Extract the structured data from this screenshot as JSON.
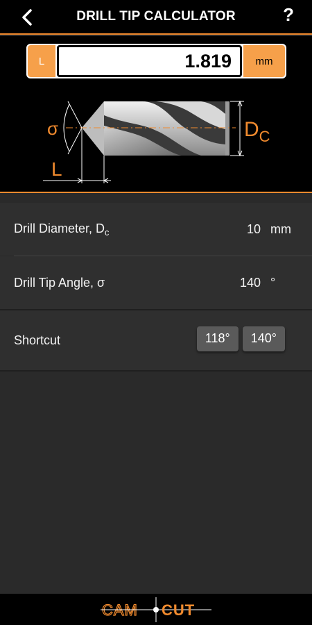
{
  "header": {
    "title": "DRILL TIP CALCULATOR",
    "help_label": "?"
  },
  "result": {
    "tag": "L",
    "value": "1.819",
    "unit": "mm"
  },
  "diagram": {
    "sigma_label": "σ",
    "L_label": "L",
    "dc_label_main": "D",
    "dc_label_sub": "C"
  },
  "rows": [
    {
      "label": "Drill Diameter, D",
      "label_sub": "c",
      "value": "10",
      "unit": "mm"
    },
    {
      "label": "Drill Tip Angle, σ",
      "value": "140",
      "unit": "°"
    }
  ],
  "shortcut": {
    "label": "Shortcut",
    "options": [
      "118°",
      "140°"
    ]
  },
  "footer": {
    "logo_left": "CAM",
    "logo_right": "CUT"
  },
  "colors": {
    "accent": "#f08a2e",
    "accent_light": "#f6a04a"
  }
}
